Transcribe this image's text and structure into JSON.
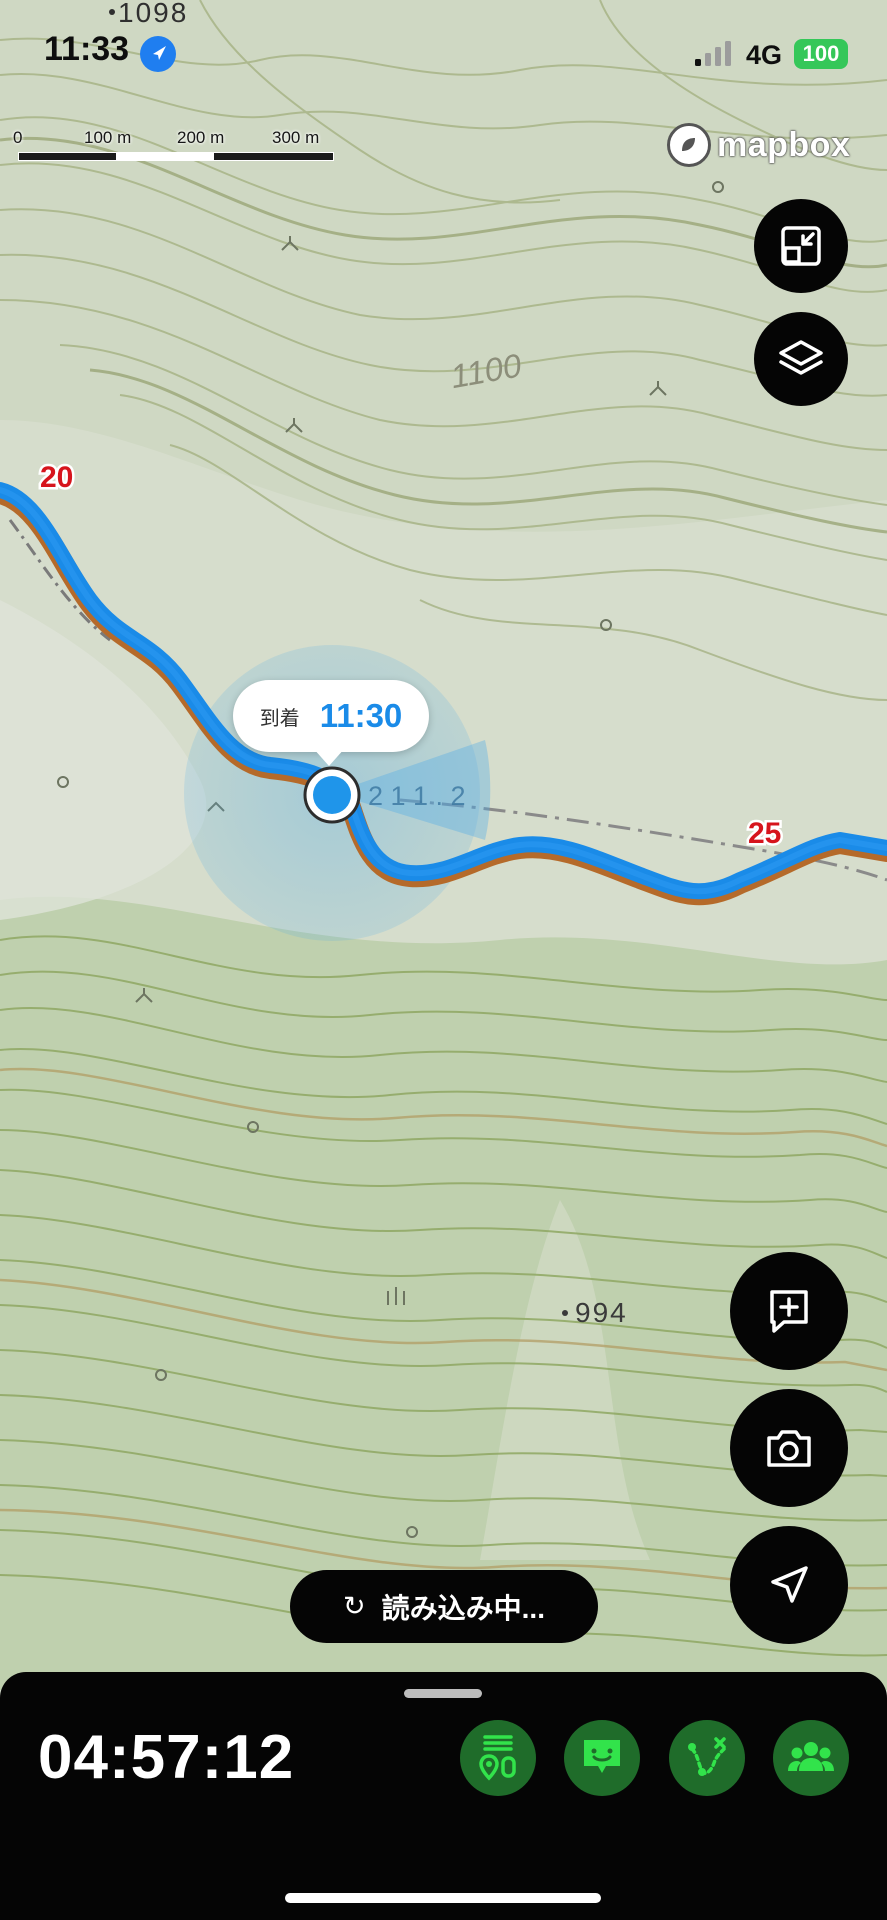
{
  "status_bar": {
    "time": "11:33",
    "network": "4G",
    "battery": "100"
  },
  "scale_bar": {
    "labels": [
      "0",
      "100 m",
      "200 m",
      "300 m"
    ]
  },
  "map": {
    "attribution": "mapbox",
    "elevation_labels": [
      "1098",
      "1100",
      "994"
    ],
    "route_markers": [
      "20",
      "25"
    ],
    "arrival_label": "到着",
    "arrival_time": "11:30",
    "map_text": "2 1 1 . 2"
  },
  "map_buttons": [
    "collapse-icon",
    "layers-icon",
    "add-note-icon",
    "camera-icon",
    "navigate-icon"
  ],
  "loading_text": "読み込み中...",
  "bottom_panel": {
    "elapsed": "04:57:12",
    "tools": [
      "route-course-icon",
      "message-icon",
      "route-edit-icon",
      "group-icon"
    ]
  },
  "colors": {
    "route": "#1a8be8",
    "route_marker": "#d6141c",
    "tool_button_bg": "#1f6c2a",
    "tool_icon": "#32e34b",
    "battery": "#35c759"
  }
}
